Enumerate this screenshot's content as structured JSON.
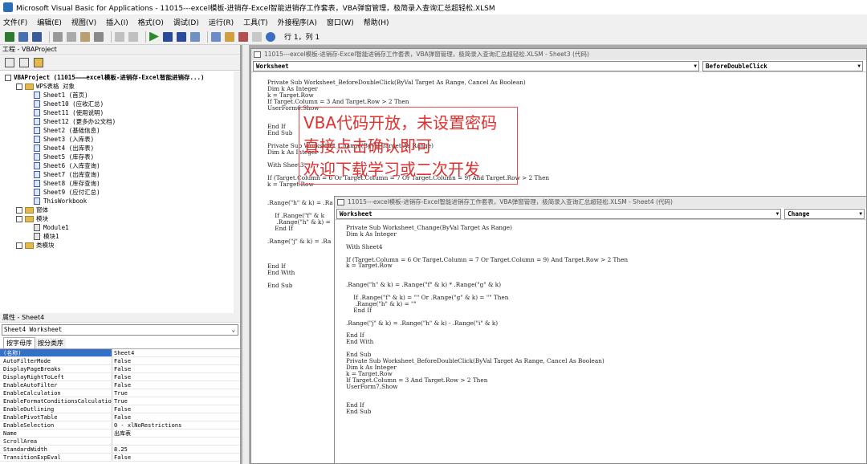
{
  "window": {
    "title": "Microsoft Visual Basic for Applications - 11015---excel模板-进销存-Excel智能进销存工作套表，VBA弹窗管理，极简录入查询汇总超轻松.XLSM"
  },
  "menu": [
    "文件(F)",
    "编辑(E)",
    "视图(V)",
    "插入(I)",
    "格式(O)",
    "调试(D)",
    "运行(R)",
    "工具(T)",
    "外接程序(A)",
    "窗口(W)",
    "帮助(H)"
  ],
  "toolbar": {
    "position": "行 1，列 1"
  },
  "project": {
    "title": "工程 - VBAProject",
    "root": "VBAProject (11015———excel模板-进销存-Excel智能进销存...)",
    "objects_folder": "WPS表格 对象",
    "sheets": [
      "Sheet1 (首页)",
      "Sheet10 (应收汇总)",
      "Sheet11 (使用说明)",
      "Sheet12 (更多办公文档)",
      "Sheet2 (基础信息)",
      "Sheet3 (入库表)",
      "Sheet4 (出库表)",
      "Sheet5 (库存表)",
      "Sheet6 (入库查询)",
      "Sheet7 (出库查询)",
      "Sheet8 (库存查询)",
      "Sheet9 (应付汇总)",
      "ThisWorkbook"
    ],
    "forms_folder": "窗体",
    "modules_folder": "模块",
    "modules": [
      "Module1",
      "模块1"
    ],
    "class_folder": "类模块"
  },
  "properties": {
    "title": "属性 - Sheet4",
    "object": "Sheet4 Worksheet",
    "tab_alpha": "按字母序",
    "tab_cat": "按分类序",
    "rows": [
      [
        "(名称)",
        "Sheet4"
      ],
      [
        "AutoFilterMode",
        "False"
      ],
      [
        "DisplayPageBreaks",
        "False"
      ],
      [
        "DisplayRightToLeft",
        "False"
      ],
      [
        "EnableAutoFilter",
        "False"
      ],
      [
        "EnableCalculation",
        "True"
      ],
      [
        "EnableFormatConditionsCalculation",
        "True"
      ],
      [
        "EnableOutlining",
        "False"
      ],
      [
        "EnablePivotTable",
        "False"
      ],
      [
        "EnableSelection",
        "0 - xlNoRestrictions"
      ],
      [
        "Name",
        "出库表"
      ],
      [
        "ScrollArea",
        ""
      ],
      [
        "StandardWidth",
        "8.25"
      ],
      [
        "TransitionExpEval",
        "False"
      ]
    ]
  },
  "code_window_1": {
    "title": "11015---excel模板-进销存-Excel智能进销存工作套表，VBA弹窗管理，极简录入查询汇总超轻松.XLSM - Sheet3 (代码)",
    "object": "Worksheet",
    "proc": "BeforeDoubleClick",
    "lines": [
      "Private Sub Worksheet_BeforeDoubleClick(ByVal Target As Range, Cancel As Boolean)",
      "Dim k As Integer",
      "k = Target.Row",
      "If Target.Column = 3 And Target.Row > 2 Then",
      "UserForm6.Show",
      "",
      "",
      "End If",
      "End Sub",
      "",
      "Private Sub Worksheet_Change(ByVal Target As Range)",
      "Dim k As Integer",
      "",
      "With Sheet3",
      "",
      "If (Target.Column = 6 Or Target.Column = 7 Or Target.Column = 9) And Target.Row > 2 Then",
      "k = Target.Row",
      "",
      "",
      ".Range(\"h\" & k) = .Ra",
      "",
      "    If .Range(\"f\" & k",
      "     .Range(\"h\" & k) =",
      "    End If",
      "",
      ".Range(\"j\" & k) = .Ra",
      "",
      "",
      "",
      "End If",
      "End With",
      "",
      "End Sub"
    ]
  },
  "code_window_2": {
    "title": "11015---excel模板-进销存-Excel智能进销存工作套表，VBA弹窗管理，极简录入查询汇总超轻松.XLSM - Sheet4 (代码)",
    "object": "Worksheet",
    "proc": "Change",
    "lines": [
      "Private Sub Worksheet_Change(ByVal Target As Range)",
      "Dim k As Integer",
      "",
      "With Sheet4",
      "",
      "If (Target.Column = 6 Or Target.Column = 7 Or Target.Column = 9) And Target.Row > 2 Then",
      "k = Target.Row",
      "",
      "",
      ".Range(\"h\" & k) = .Range(\"f\" & k) * .Range(\"g\" & k)",
      "",
      "    If .Range(\"f\" & k) = \"\" Or .Range(\"g\" & k) = \"\" Then",
      "     .Range(\"h\" & k) = \"\"",
      "    End If",
      "",
      ".Range(\"j\" & k) = .Range(\"h\" & k) - .Range(\"i\" & k)",
      "",
      "End If",
      "End With",
      "",
      "End Sub",
      "Private Sub Worksheet_BeforeDoubleClick(ByVal Target As Range, Cancel As Boolean)",
      "Dim k As Integer",
      "k = Target.Row",
      "If Target.Column = 3 And Target.Row > 2 Then",
      "UserForm7.Show",
      "",
      "",
      "End If",
      "End Sub"
    ]
  },
  "watermark": [
    "VBA代码开放，未设置密码",
    "直接点击确认即可",
    "欢迎下载学习或二次开发"
  ]
}
